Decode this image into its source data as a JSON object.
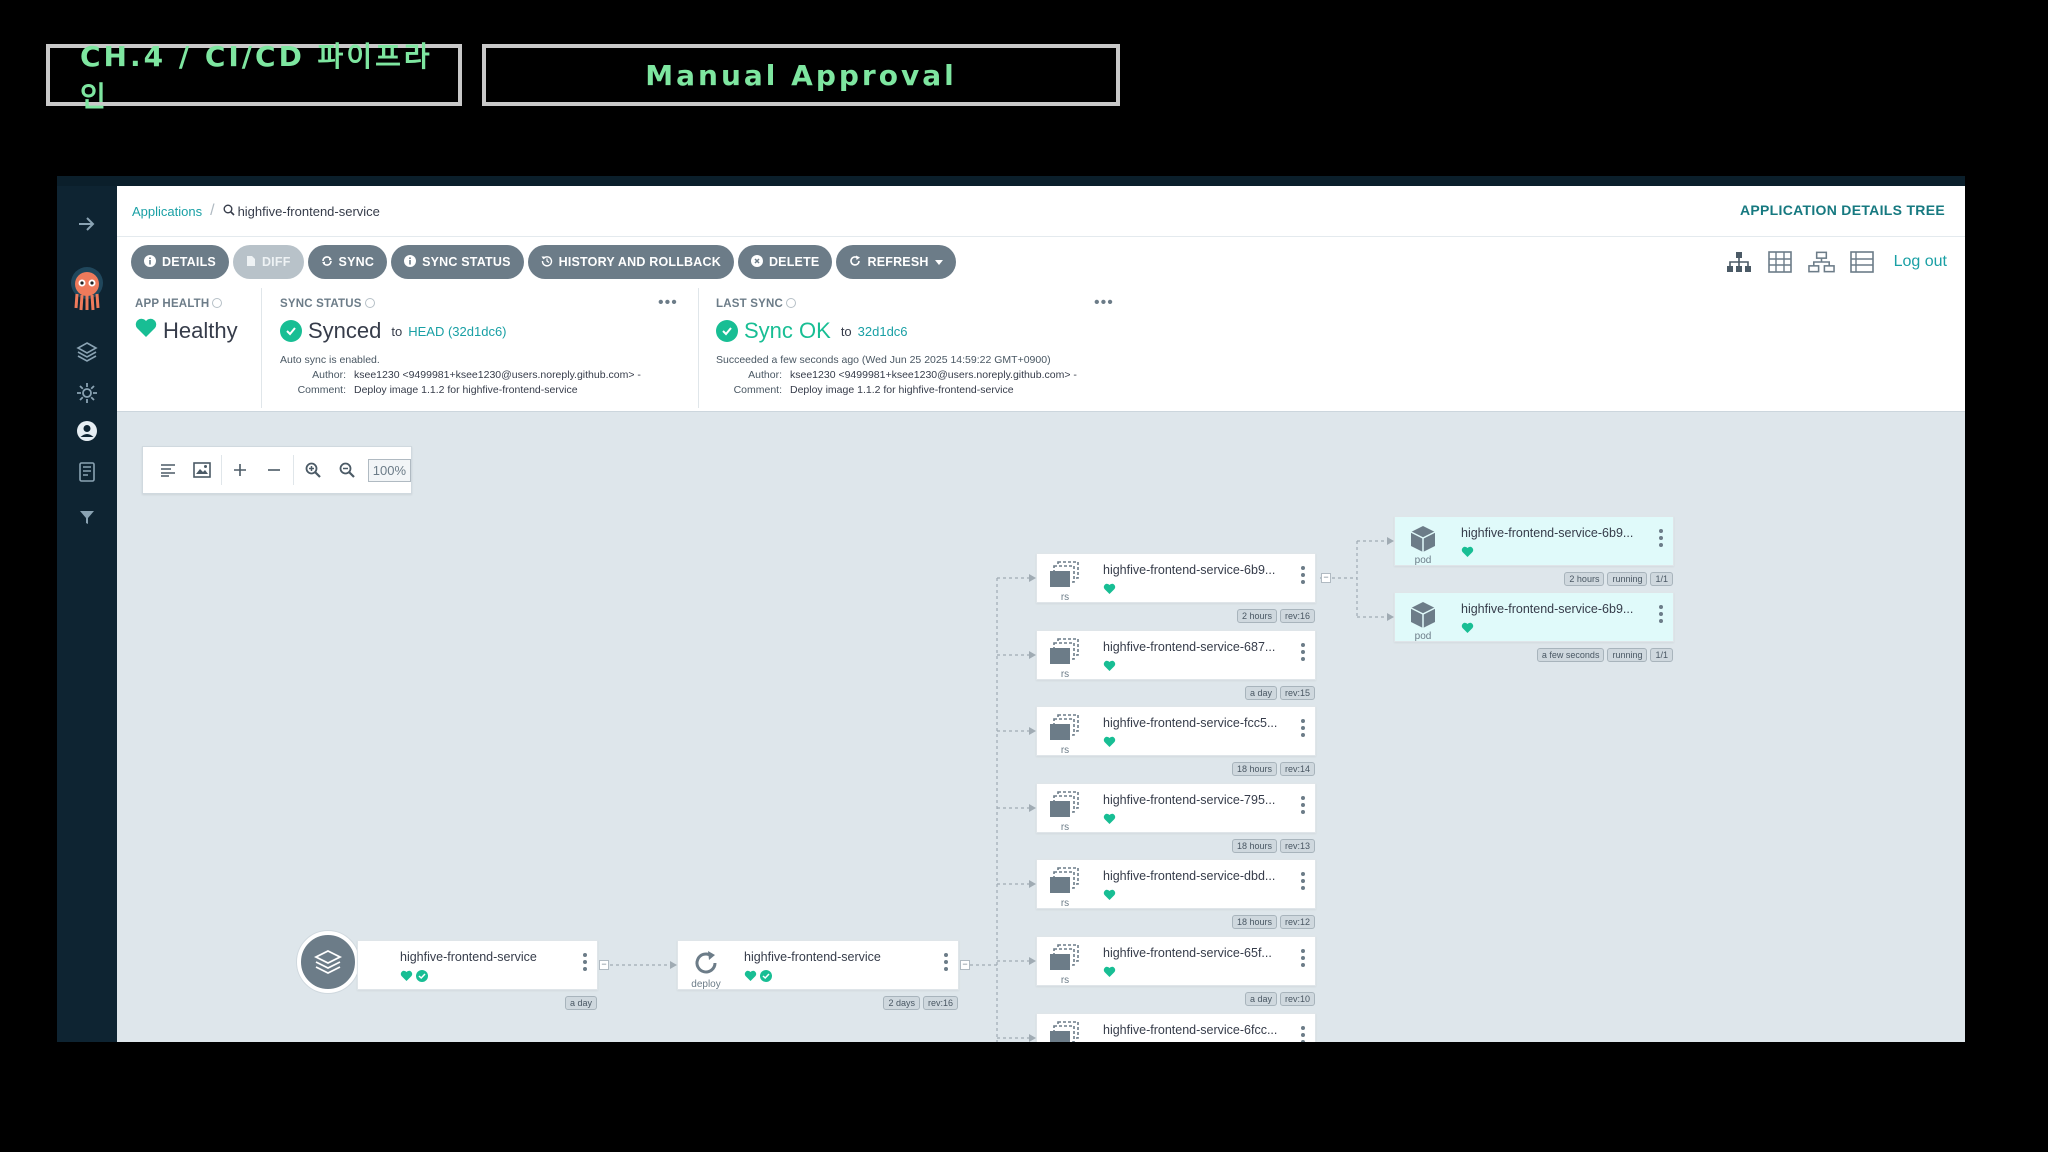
{
  "slide": {
    "chapter": "CH.4 / CI/CD 파이프라인",
    "topic": "Manual Approval"
  },
  "colors": {
    "accent": "#1aa0a5",
    "healthy": "#18be94",
    "slide_text": "#7ee6a0",
    "button_bg": "#6c7c88"
  },
  "breadcrumb": {
    "root": "Applications",
    "current": "highfive-frontend-service"
  },
  "page_label": "APPLICATION DETAILS TREE",
  "actions": [
    {
      "label": "DETAILS",
      "icon": "info-icon",
      "disabled": false
    },
    {
      "label": "DIFF",
      "icon": "file-icon",
      "disabled": true
    },
    {
      "label": "SYNC",
      "icon": "sync-icon",
      "disabled": false
    },
    {
      "label": "SYNC STATUS",
      "icon": "info-icon",
      "disabled": false
    },
    {
      "label": "HISTORY AND ROLLBACK",
      "icon": "history-icon",
      "disabled": false
    },
    {
      "label": "DELETE",
      "icon": "delete-icon",
      "disabled": false
    },
    {
      "label": "REFRESH",
      "icon": "refresh-icon",
      "disabled": false
    }
  ],
  "logout": "Log out",
  "app_health": {
    "label": "APP HEALTH",
    "value": "Healthy"
  },
  "sync_status": {
    "label": "SYNC STATUS",
    "value": "Synced",
    "to": "to",
    "revision": "HEAD (32d1dc6)",
    "note": "Auto sync is enabled.",
    "author_key": "Author:",
    "author": "ksee1230 <9499981+ksee1230@users.noreply.github.com> -",
    "comment_key": "Comment:",
    "comment": "Deploy image 1.1.2 for highfive-frontend-service"
  },
  "last_sync": {
    "label": "LAST SYNC",
    "value": "Sync OK",
    "to": "to",
    "revision": "32d1dc6",
    "note": "Succeeded a few seconds ago (Wed Jun 25 2025 14:59:22 GMT+0900)",
    "author_key": "Author:",
    "author": "ksee1230 <9499981+ksee1230@users.noreply.github.com> -",
    "comment_key": "Comment:",
    "comment": "Deploy image 1.1.2 for highfive-frontend-service"
  },
  "graph_tools": {
    "zoom": "100%"
  },
  "graph": {
    "app_node": {
      "name": "highfive-frontend-service",
      "tags": [
        "a day"
      ]
    },
    "deploy_node": {
      "name": "highfive-frontend-service",
      "kind": "deploy",
      "tags": [
        "2 days",
        "rev:16"
      ]
    },
    "replicasets": [
      {
        "name": "highfive-frontend-service-6b9...",
        "kind": "rs",
        "tags": [
          "2 hours",
          "rev:16"
        ]
      },
      {
        "name": "highfive-frontend-service-687...",
        "kind": "rs",
        "tags": [
          "a day",
          "rev:15"
        ]
      },
      {
        "name": "highfive-frontend-service-fcc5...",
        "kind": "rs",
        "tags": [
          "18 hours",
          "rev:14"
        ]
      },
      {
        "name": "highfive-frontend-service-795...",
        "kind": "rs",
        "tags": [
          "18 hours",
          "rev:13"
        ]
      },
      {
        "name": "highfive-frontend-service-dbd...",
        "kind": "rs",
        "tags": [
          "18 hours",
          "rev:12"
        ]
      },
      {
        "name": "highfive-frontend-service-65f...",
        "kind": "rs",
        "tags": [
          "a day",
          "rev:10"
        ]
      },
      {
        "name": "highfive-frontend-service-6fcc...",
        "kind": "rs",
        "tags": []
      }
    ],
    "pods": [
      {
        "name": "highfive-frontend-service-6b9...",
        "kind": "pod",
        "tags": [
          "2 hours",
          "running",
          "1/1"
        ]
      },
      {
        "name": "highfive-frontend-service-6b9...",
        "kind": "pod",
        "tags": [
          "a few seconds",
          "running",
          "1/1"
        ]
      }
    ]
  }
}
